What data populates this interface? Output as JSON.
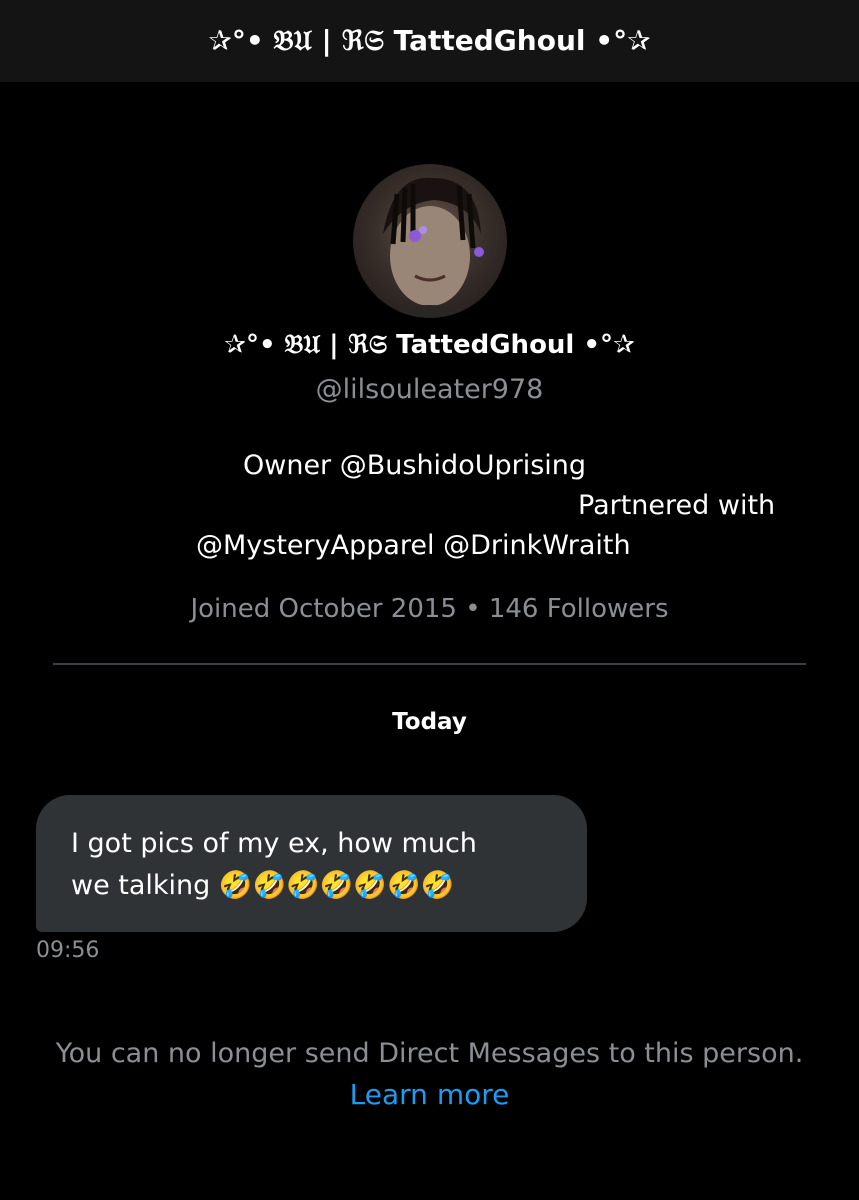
{
  "header": {
    "title": "✰°• 𝔅𝔘 | ℜ𝔖 TattedGhoul •°✰"
  },
  "profile": {
    "display_name": "✰°• 𝔅𝔘 | ℜ𝔖 TattedGhoul •°✰",
    "handle": "@lilsouleater978",
    "bio_lines": [
      "Owner @BushidoUprising",
      "Partnered with",
      "@MysteryApparel @DrinkWraith"
    ],
    "meta": "Joined October 2015 • 146 Followers"
  },
  "conversation": {
    "date_separator": "Today",
    "messages": [
      {
        "text": "I got pics of my ex, how much\nwe talking 🤣🤣🤣🤣🤣🤣🤣",
        "time": "09:56"
      }
    ]
  },
  "footer": {
    "notice": "You can no longer send Direct Messages to this person.",
    "learn_more": "Learn more"
  },
  "colors": {
    "background": "#000000",
    "header_bg": "#141414",
    "bubble_bg": "#2f3336",
    "secondary_text": "#8b8f94",
    "link": "#1d9bf0"
  }
}
